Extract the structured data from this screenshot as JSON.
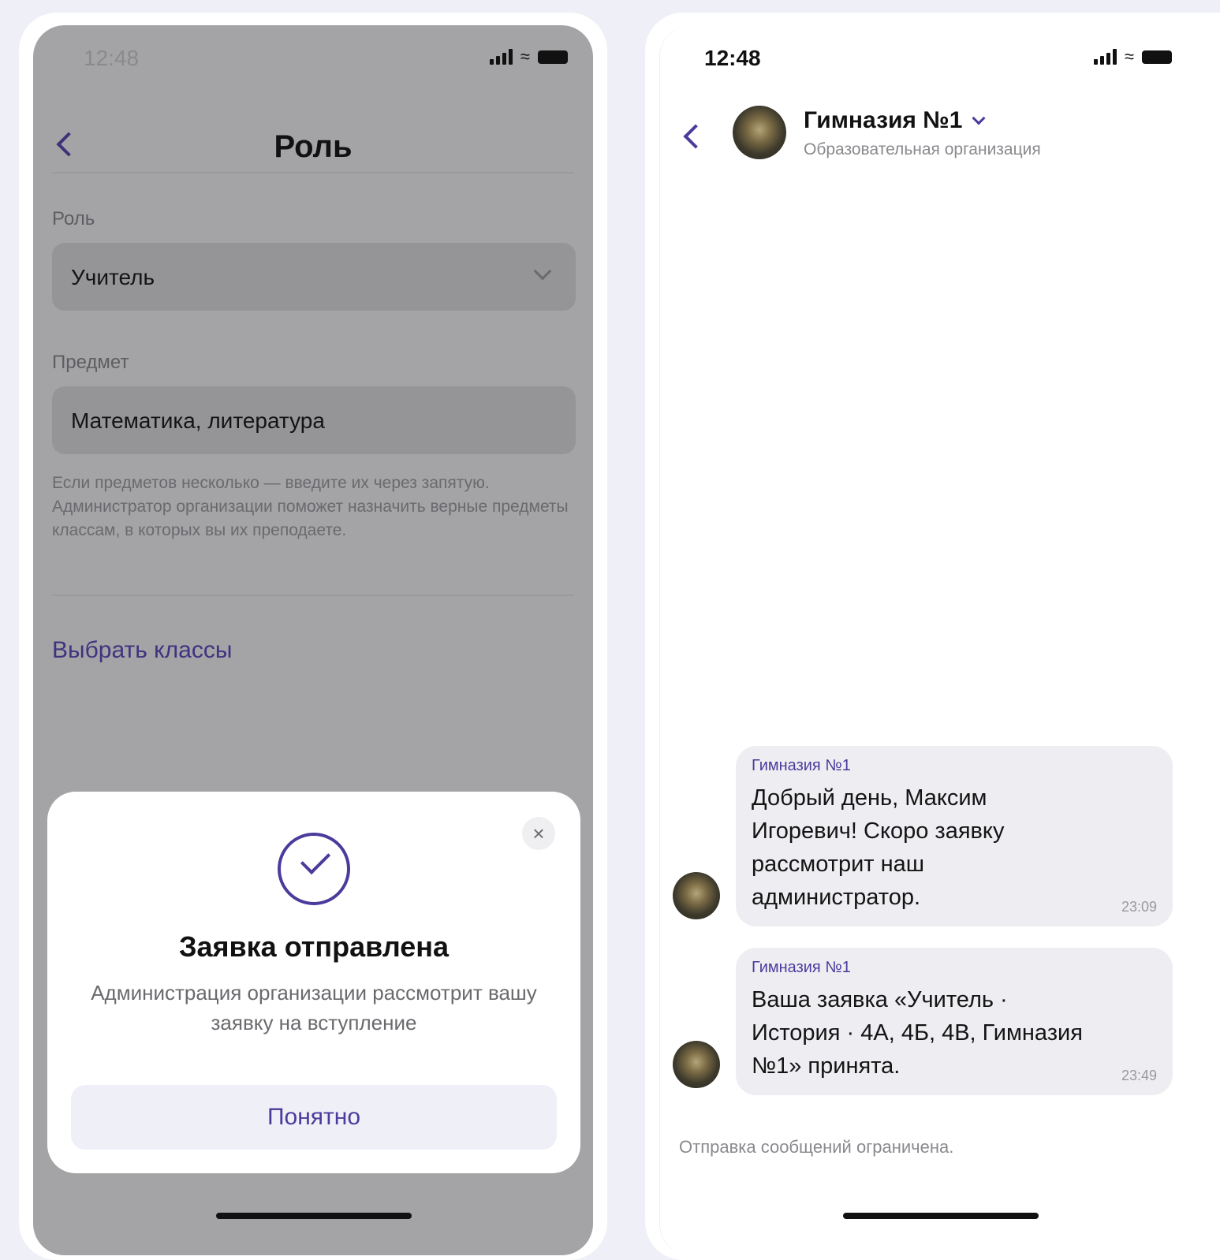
{
  "left_screen": {
    "status_time": "12:48",
    "header": {
      "title": "Роль"
    },
    "role": {
      "label": "Роль",
      "value": "Учитель"
    },
    "subject": {
      "label": "Предмет",
      "value": "Математика, литература",
      "hint": "Если предметов несколько — введите их через запятую. Администратор организации поможет назначить верные предметы классам, в которых вы их преподаете."
    },
    "choose_classes_link": "Выбрать классы",
    "modal": {
      "title": "Заявка отправлена",
      "text": "Администрация организации рассмотрит вашу заявку на вступление",
      "button": "Понятно",
      "close_icon": "×"
    }
  },
  "right_screen": {
    "status_time": "12:48",
    "chat": {
      "name": "Гимназия №1",
      "subtitle": "Образовательная организация"
    },
    "messages": [
      {
        "sender": "Гимназия №1",
        "text": "Добрый день, Максим Игоревич! Скоро заявку рассмотрит наш администратор.",
        "time": "23:09"
      },
      {
        "sender": "Гимназия №1",
        "text": "Ваша заявка «Учитель · История · 4А, 4Б, 4В, Гимназия №1» принята.",
        "time": "23:49"
      }
    ],
    "restricted_notice": "Отправка сообщений ограничена."
  },
  "colors": {
    "accent": "#4c3a9c",
    "dimmed_overlay": "#a4a4a6",
    "bubble": "#eeeef2",
    "page_background": "#efeff7"
  }
}
